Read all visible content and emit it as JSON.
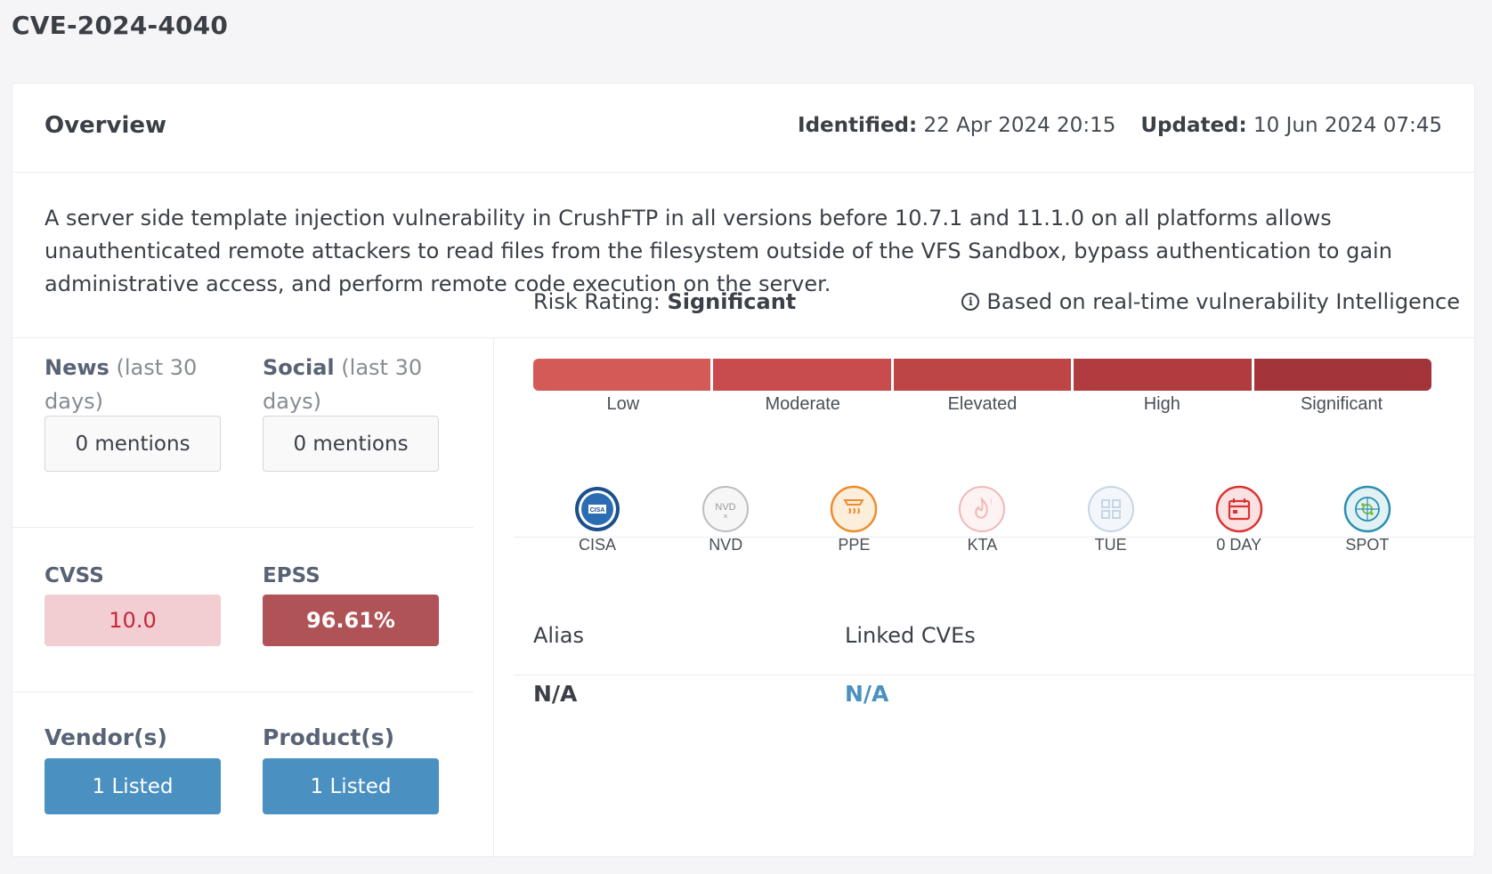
{
  "page": {
    "title": "CVE-2024-4040"
  },
  "overview": {
    "title": "Overview",
    "identified_label": "Identified:",
    "identified_value": "22 Apr 2024 20:15",
    "updated_label": "Updated:",
    "updated_value": "10 Jun 2024 07:45",
    "description": "A server side template injection vulnerability in CrushFTP in all versions before 10.7.1 and 11.1.0 on all platforms allows unauthenticated remote attackers to read files from the filesystem outside of the VFS Sandbox, bypass authentication to gain administrative access, and perform remote code execution on the server."
  },
  "mentions": {
    "news": {
      "label": "News",
      "period": "(last 30 days)",
      "value": "0 mentions"
    },
    "social": {
      "label": "Social",
      "period": "(last 30 days)",
      "value": "0 mentions"
    }
  },
  "metrics": {
    "cvss": {
      "label": "CVSS",
      "value": "10.0"
    },
    "epss": {
      "label": "EPSS",
      "value": "96.61%"
    }
  },
  "listings": {
    "vendors": {
      "label": "Vendor(s)",
      "value": "1 Listed"
    },
    "products": {
      "label": "Product(s)",
      "value": "1 Listed"
    }
  },
  "risk": {
    "label": "Risk Rating:",
    "rating": "Significant",
    "based_on": "Based on real-time vulnerability Intelligence",
    "levels": [
      "Low",
      "Moderate",
      "Elevated",
      "High",
      "Significant"
    ],
    "colors": [
      "#d45a57",
      "#c84c4d",
      "#bd4546",
      "#b13c40",
      "#a3343a"
    ]
  },
  "badges": [
    {
      "label": "CISA",
      "icon": "cisa-seal-icon",
      "active": true
    },
    {
      "label": "NVD",
      "icon": "nvd-icon",
      "active": false
    },
    {
      "label": "PPE",
      "icon": "ppe-icon",
      "active": true
    },
    {
      "label": "KTA",
      "icon": "kta-icon",
      "active": false
    },
    {
      "label": "TUE",
      "icon": "tue-icon",
      "active": false
    },
    {
      "label": "0 DAY",
      "icon": "zero-day-calendar-icon",
      "active": true
    },
    {
      "label": "SPOT",
      "icon": "spot-icon",
      "active": true
    }
  ],
  "alias": {
    "label": "Alias",
    "value": "N/A"
  },
  "linked_cves": {
    "label": "Linked CVEs",
    "value": "N/A"
  }
}
